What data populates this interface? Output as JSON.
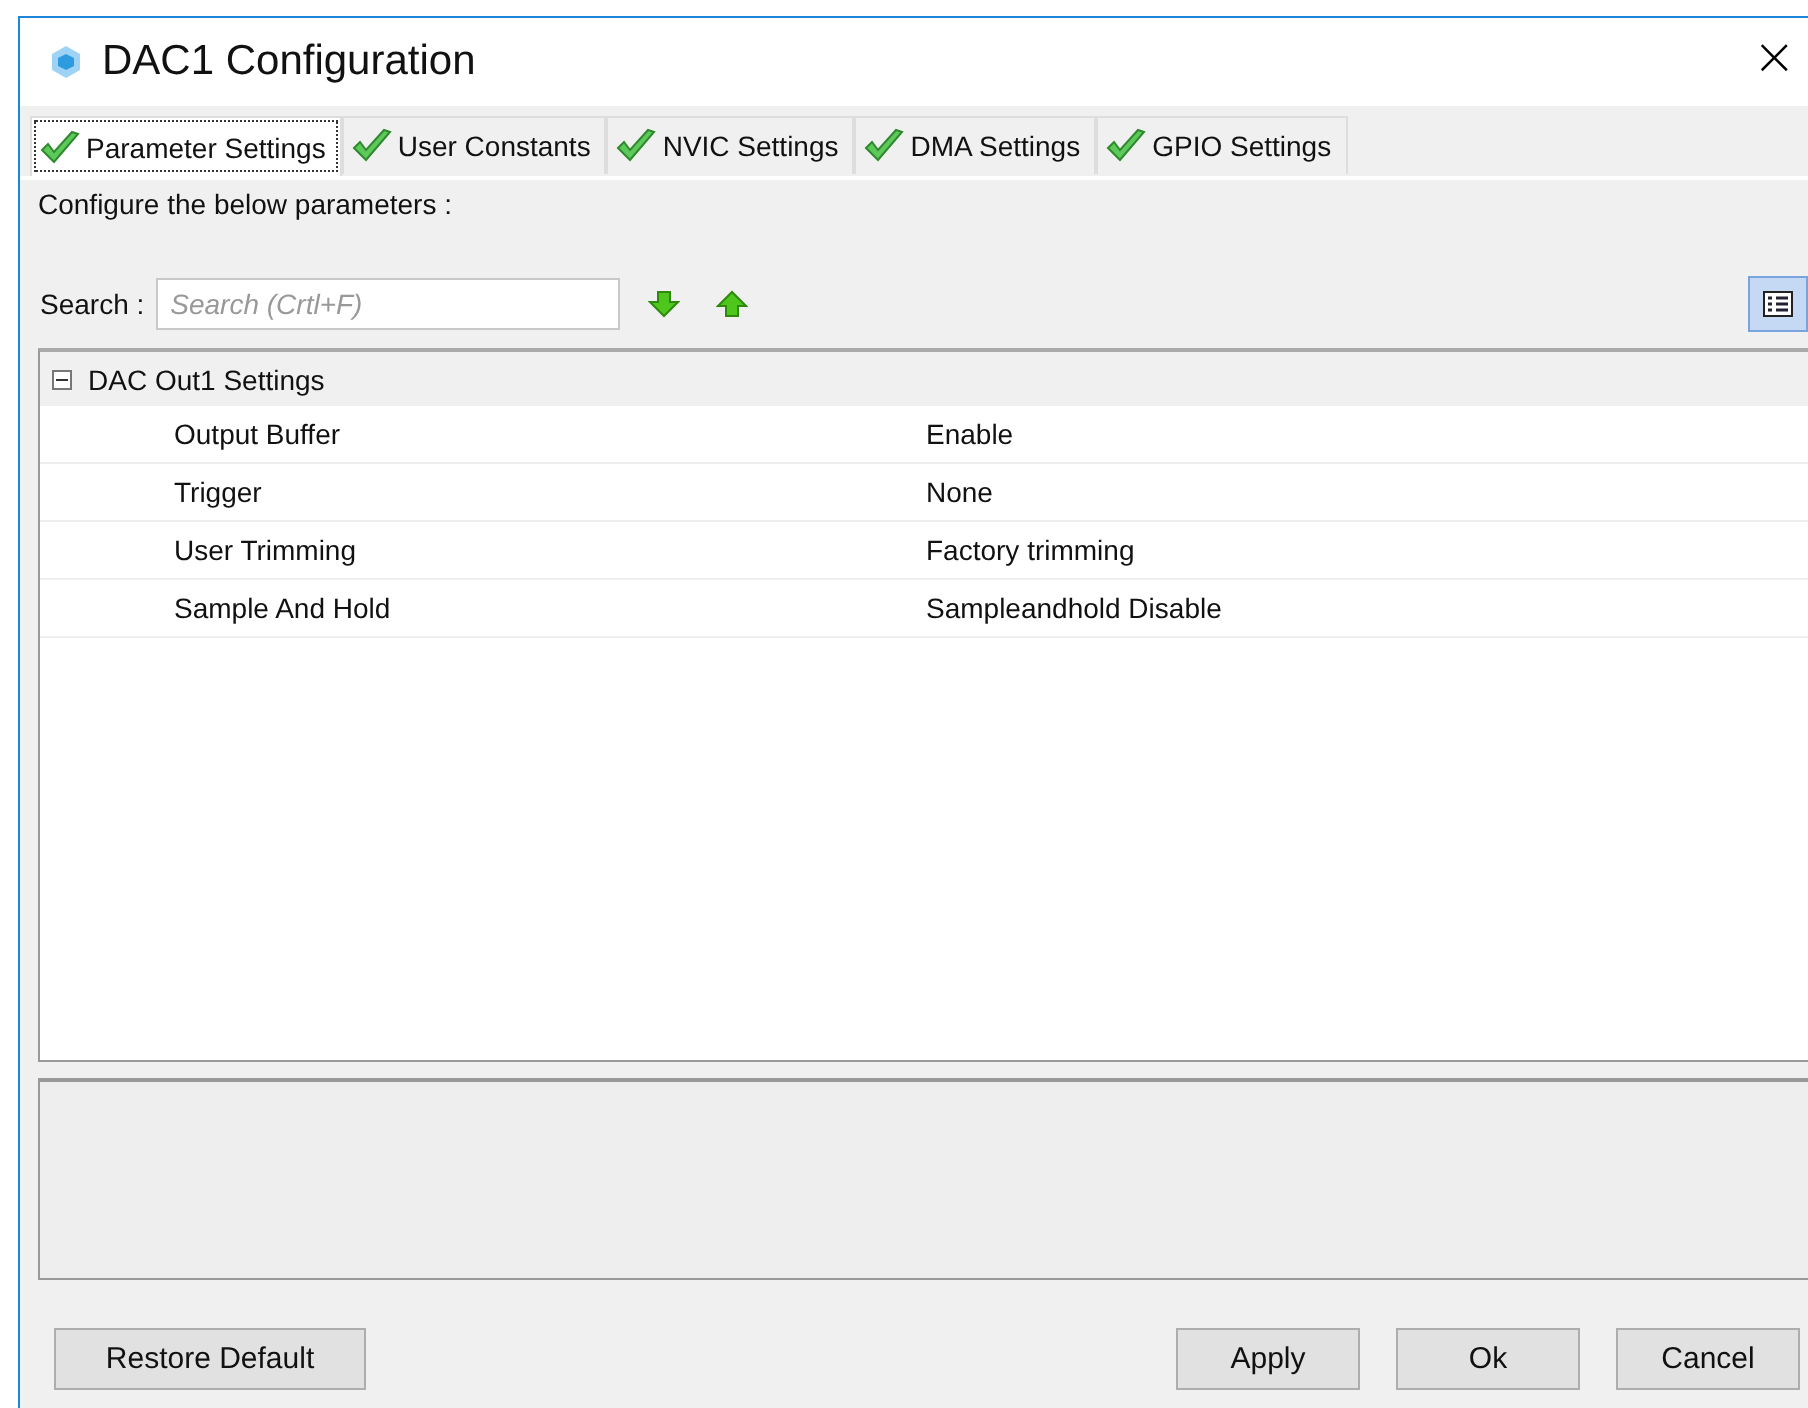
{
  "window": {
    "title": "DAC1 Configuration",
    "close": "×"
  },
  "tabs": [
    {
      "label": "Parameter Settings",
      "selected": true,
      "valid": true
    },
    {
      "label": "User Constants",
      "selected": false,
      "valid": true
    },
    {
      "label": "NVIC Settings",
      "selected": false,
      "valid": true
    },
    {
      "label": "DMA Settings",
      "selected": false,
      "valid": true
    },
    {
      "label": "GPIO Settings",
      "selected": false,
      "valid": true
    }
  ],
  "instruction": "Configure the below parameters :",
  "search": {
    "label": "Search :",
    "placeholder": "Search (Crtl+F)"
  },
  "view_toggle": {
    "on": true
  },
  "tree": [
    {
      "label": "DAC Out1 Settings",
      "expanded": true,
      "children": [
        {
          "name": "Output Buffer",
          "value": "Enable"
        },
        {
          "name": "Trigger",
          "value": "None"
        },
        {
          "name": "User Trimming",
          "value": "Factory trimming"
        },
        {
          "name": "Sample And Hold",
          "value": "Sampleandhold Disable"
        }
      ]
    }
  ],
  "buttons": [
    {
      "label": "Restore Default",
      "kind": "left"
    },
    {
      "label": "Apply",
      "kind": "right"
    },
    {
      "label": "Ok",
      "kind": "right"
    },
    {
      "label": "Cancel",
      "kind": "right"
    }
  ]
}
